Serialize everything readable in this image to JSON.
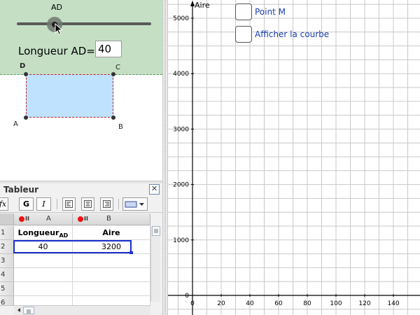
{
  "slider": {
    "label": "AD",
    "value": 40,
    "min": 0,
    "max": 150
  },
  "longueur": {
    "label": "Longueur AD=",
    "value": "40"
  },
  "points": {
    "A": "A",
    "B": "B",
    "C": "C",
    "D": "D"
  },
  "spreadsheet": {
    "title": "Tableur",
    "close_label": "✕",
    "toolbar": {
      "fx": "fx",
      "bold": "G",
      "italic": "I"
    },
    "columns": [
      "A",
      "B"
    ],
    "rows": [
      "1",
      "2",
      "3",
      "4",
      "5",
      "6"
    ],
    "cells": {
      "A1_main": "Longueur",
      "A1_sub": "AD",
      "B1": "Aire",
      "A2": "40",
      "B2": "3200"
    }
  },
  "graph": {
    "checkboxes": [
      {
        "label": "Point M",
        "checked": false
      },
      {
        "label": "Afficher la courbe",
        "checked": false
      }
    ]
  },
  "chart_data": {
    "type": "scatter",
    "ylabel": "Aire",
    "xlabel": "",
    "x_ticks": [
      "0",
      "20",
      "40",
      "60",
      "80",
      "100",
      "120",
      "140"
    ],
    "y_ticks": [
      "0",
      "1000",
      "2000",
      "3000",
      "4000",
      "5000"
    ],
    "xlim": [
      0,
      160
    ],
    "ylim": [
      0,
      5300
    ],
    "grid": true,
    "series": []
  },
  "colors": {
    "green_zone": "#c5dfc5",
    "rectangle_fill": "#bfe2ff",
    "rectangle_border": "#c02020",
    "checkbox_label": "#1a3fb0",
    "selection_border": "#1a2fd0"
  }
}
